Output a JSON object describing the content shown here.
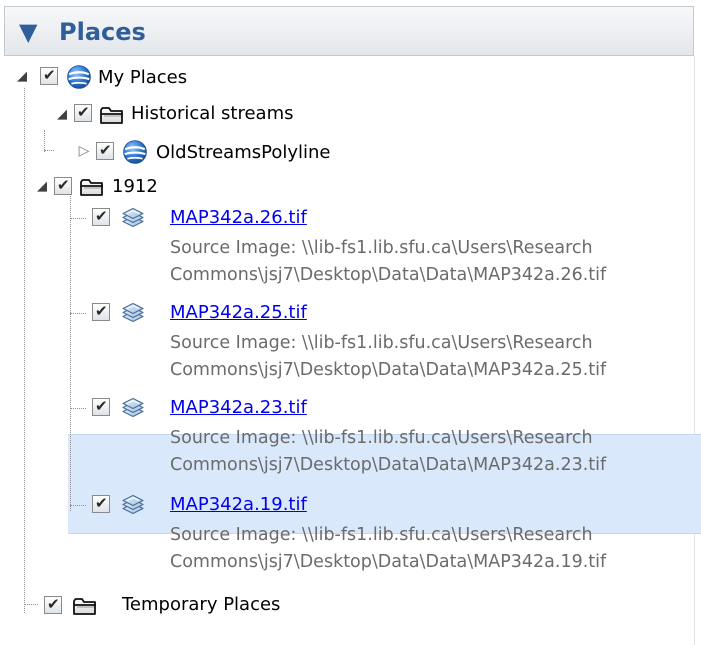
{
  "panel": {
    "title": "Places",
    "title_color": "#2f5f9a",
    "caret_icon": "triangle-down-icon"
  },
  "tree": {
    "my_places": {
      "label": "My Places",
      "checked": true,
      "expanded": true,
      "icon": "globe-icon"
    },
    "historical_streams": {
      "label": "Historical streams",
      "checked": true,
      "expanded": true,
      "icon": "folder-icon"
    },
    "old_streams": {
      "label": "OldStreamsPolyline",
      "checked": true,
      "expanded": false,
      "icon": "globe-icon"
    },
    "folder_1912": {
      "label": "1912",
      "checked": true,
      "expanded": true,
      "icon": "folder-icon"
    },
    "overlays": [
      {
        "name": "MAP342a.26.tif",
        "checked": true,
        "selected": false,
        "icon": "image-overlay-icon",
        "desc_line1": "Source Image: \\\\lib-fs1.lib.sfu.ca\\Users\\Research",
        "desc_line2": "Commons\\jsj7\\Desktop\\Data\\Data\\MAP342a.26.tif"
      },
      {
        "name": "MAP342a.25.tif",
        "checked": true,
        "selected": false,
        "icon": "image-overlay-icon",
        "desc_line1": "Source Image: \\\\lib-fs1.lib.sfu.ca\\Users\\Research",
        "desc_line2": "Commons\\jsj7\\Desktop\\Data\\Data\\MAP342a.25.tif"
      },
      {
        "name": "MAP342a.23.tif",
        "checked": true,
        "selected": false,
        "icon": "image-overlay-icon",
        "desc_line1": "Source Image: \\\\lib-fs1.lib.sfu.ca\\Users\\Research",
        "desc_line2": "Commons\\jsj7\\Desktop\\Data\\Data\\MAP342a.23.tif"
      },
      {
        "name": "MAP342a.19.tif",
        "checked": true,
        "selected": true,
        "icon": "image-overlay-icon",
        "desc_line1": "Source Image: \\\\lib-fs1.lib.sfu.ca\\Users\\Research",
        "desc_line2": "Commons\\jsj7\\Desktop\\Data\\Data\\MAP342a.19.tif"
      }
    ],
    "temporary_places": {
      "label": "Temporary Places",
      "checked": true,
      "icon": "folder-icon"
    }
  },
  "colors": {
    "link": "#0000ee",
    "selection": "#d9e8fb",
    "description": "#6b6b6b"
  }
}
